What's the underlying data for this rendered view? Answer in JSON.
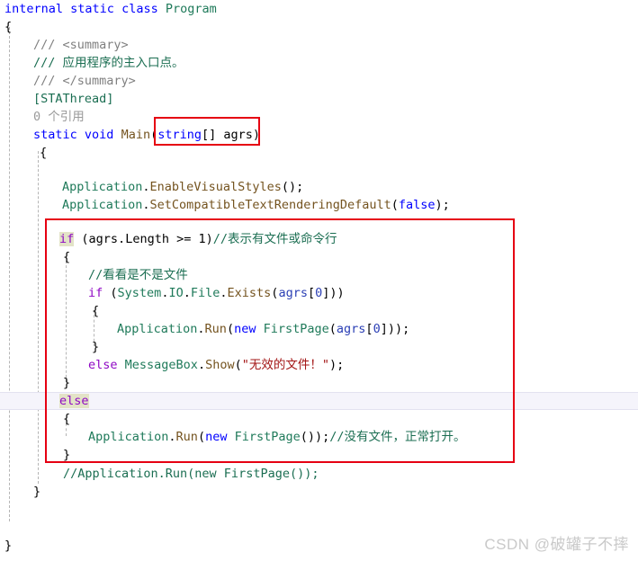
{
  "editor": {
    "language": "csharp",
    "colors": {
      "keyword_blue": "#0000ff",
      "control_purple": "#8f08c4",
      "comment_green": "#1b6e52",
      "string_red": "#a31515",
      "method_brown": "#74531f",
      "identifier_blue": "#2b3fb5",
      "codelens_gray": "#9a9a9a",
      "annotation_red": "#e60012",
      "match_highlight": "#e3e3c7",
      "current_line": "#f5f4fb"
    },
    "lines": [
      {
        "n": 1,
        "indent": 0,
        "text": "internal static class Program"
      },
      {
        "n": 2,
        "indent": 0,
        "text": "{"
      },
      {
        "n": 3,
        "indent": 1,
        "text": "/// <summary>"
      },
      {
        "n": 4,
        "indent": 1,
        "text": "/// 应用程序的主入口点。"
      },
      {
        "n": 5,
        "indent": 1,
        "text": "/// </summary>"
      },
      {
        "n": 6,
        "indent": 1,
        "text": "[STAThread]"
      },
      {
        "n": 7,
        "indent": 1,
        "text": "0 个引用",
        "kind": "codelens"
      },
      {
        "n": 8,
        "indent": 1,
        "text": "static void Main(string[] agrs)"
      },
      {
        "n": 9,
        "indent": 1,
        "text": "{"
      },
      {
        "n": 10,
        "indent": 0,
        "text": ""
      },
      {
        "n": 11,
        "indent": 2,
        "text": "Application.EnableVisualStyles();"
      },
      {
        "n": 12,
        "indent": 2,
        "text": "Application.SetCompatibleTextRenderingDefault(false);"
      },
      {
        "n": 13,
        "indent": 0,
        "text": ""
      },
      {
        "n": 14,
        "indent": 2,
        "text": "if (agrs.Length >= 1)//表示有文件或命令行"
      },
      {
        "n": 15,
        "indent": 2,
        "text": "{"
      },
      {
        "n": 16,
        "indent": 3,
        "text": "//看看是不是文件"
      },
      {
        "n": 17,
        "indent": 3,
        "text": "if (System.IO.File.Exists(agrs[0]))"
      },
      {
        "n": 18,
        "indent": 3,
        "text": "{"
      },
      {
        "n": 19,
        "indent": 4,
        "text": "Application.Run(new FirstPage(agrs[0]));"
      },
      {
        "n": 20,
        "indent": 3,
        "text": "}"
      },
      {
        "n": 21,
        "indent": 3,
        "text": "else MessageBox.Show(\"无效的文件！\");"
      },
      {
        "n": 22,
        "indent": 2,
        "text": "}"
      },
      {
        "n": 23,
        "indent": 2,
        "text": "else",
        "current": true
      },
      {
        "n": 24,
        "indent": 2,
        "text": "{"
      },
      {
        "n": 25,
        "indent": 3,
        "text": "Application.Run(new FirstPage());//没有文件，正常打开。"
      },
      {
        "n": 26,
        "indent": 2,
        "text": "}"
      },
      {
        "n": 27,
        "indent": 2,
        "text": "//Application.Run(new FirstPage());"
      },
      {
        "n": 28,
        "indent": 1,
        "text": "}"
      },
      {
        "n": 29,
        "indent": 0,
        "text": ""
      },
      {
        "n": 30,
        "indent": 0,
        "text": ""
      },
      {
        "n": 31,
        "indent": 0,
        "text": "}"
      }
    ],
    "annotations": [
      {
        "id": "main-params-box",
        "label": "string[] agrs)"
      },
      {
        "id": "if-else-block-box",
        "label": "if/else command-line branch"
      }
    ]
  },
  "watermark": {
    "text": "CSDN @破罐子不摔"
  },
  "tokens": {
    "k_internal": "internal",
    "k_static": "static",
    "k_class": "class",
    "t_program": "Program",
    "brace_open": "{",
    "brace_close": "}",
    "doc_summary_open": "/// <summary>",
    "doc_summary_text": "/// 应用程序的主入口点。",
    "doc_summary_close": "/// </summary>",
    "attr_stathread": "[STAThread]",
    "codelens_refs": "0 个引用",
    "k_void": "void",
    "m_main": "Main",
    "k_string": "string",
    "p_agrs": "agrs",
    "c_application": "Application",
    "m_enablevisualstyles": "EnableVisualStyles",
    "m_setcompat": "SetCompatibleTextRenderingDefault",
    "k_false": "false",
    "k_if": "if",
    "k_else": "else",
    "p_length": "Length",
    "cmt_cmdline": "//表示有文件或命令行",
    "cmt_isfile": "//看看是不是文件",
    "ns_system": "System",
    "ns_io": "IO",
    "c_file": "File",
    "m_exists": "Exists",
    "m_run": "Run",
    "k_new": "new",
    "c_firstpage": "FirstPage",
    "c_messagebox": "MessageBox",
    "m_show": "Show",
    "str_invalidfile": "\"无效的文件！\"",
    "cmt_nofile": "//没有文件，正常打开。",
    "cmt_commented_run": "//Application.Run(new FirstPage());"
  }
}
